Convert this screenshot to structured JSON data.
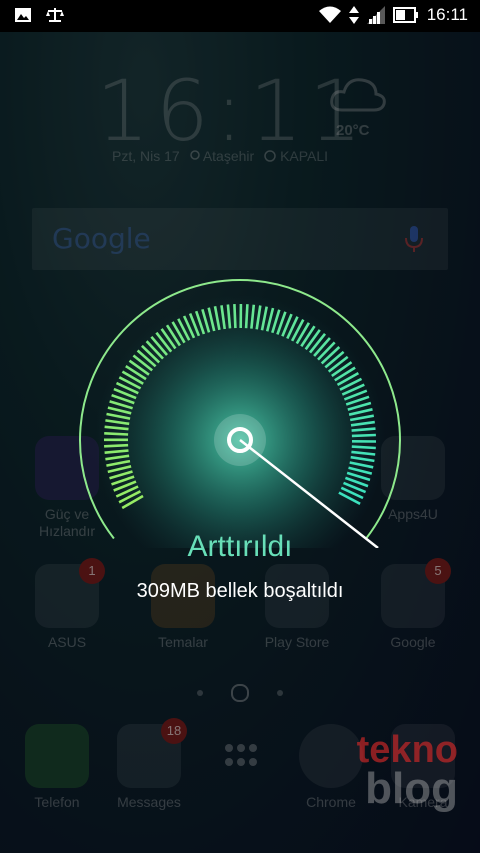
{
  "status_bar": {
    "time": "16:11",
    "icons": [
      "image-icon",
      "balance-icon",
      "wifi-icon",
      "data-arrows-icon",
      "signal-icon",
      "battery-icon"
    ]
  },
  "clock": {
    "time": "16:11"
  },
  "date_row": {
    "date": "Pzt, Nis 17",
    "location": "Ataşehir",
    "alarm": "KAPALI"
  },
  "weather": {
    "temp": "20°C",
    "icon": "cloud-icon"
  },
  "search": {
    "logo": "Google",
    "icon": "mic-icon"
  },
  "apps": {
    "guc": {
      "label": "Güç ve Hızlandır"
    },
    "apps4u": {
      "label": "Apps4U"
    },
    "asus": {
      "label": "ASUS",
      "badge": "1"
    },
    "temalar": {
      "label": "Temalar"
    },
    "playstore": {
      "label": "Play Store"
    },
    "google": {
      "label": "Google",
      "badge": "5"
    }
  },
  "dock": {
    "telefon": {
      "label": "Telefon"
    },
    "messages": {
      "label": "Messages",
      "badge": "18"
    },
    "drawer": {
      "label": ""
    },
    "chrome": {
      "label": "Chrome"
    },
    "kamera": {
      "label": "Kamera"
    }
  },
  "boost": {
    "title": "Arttırıldı",
    "message": "309MB bellek boşaltıldı",
    "accent": "#68dfb8"
  },
  "watermark": {
    "line1": "tekno",
    "line2": "blog"
  }
}
